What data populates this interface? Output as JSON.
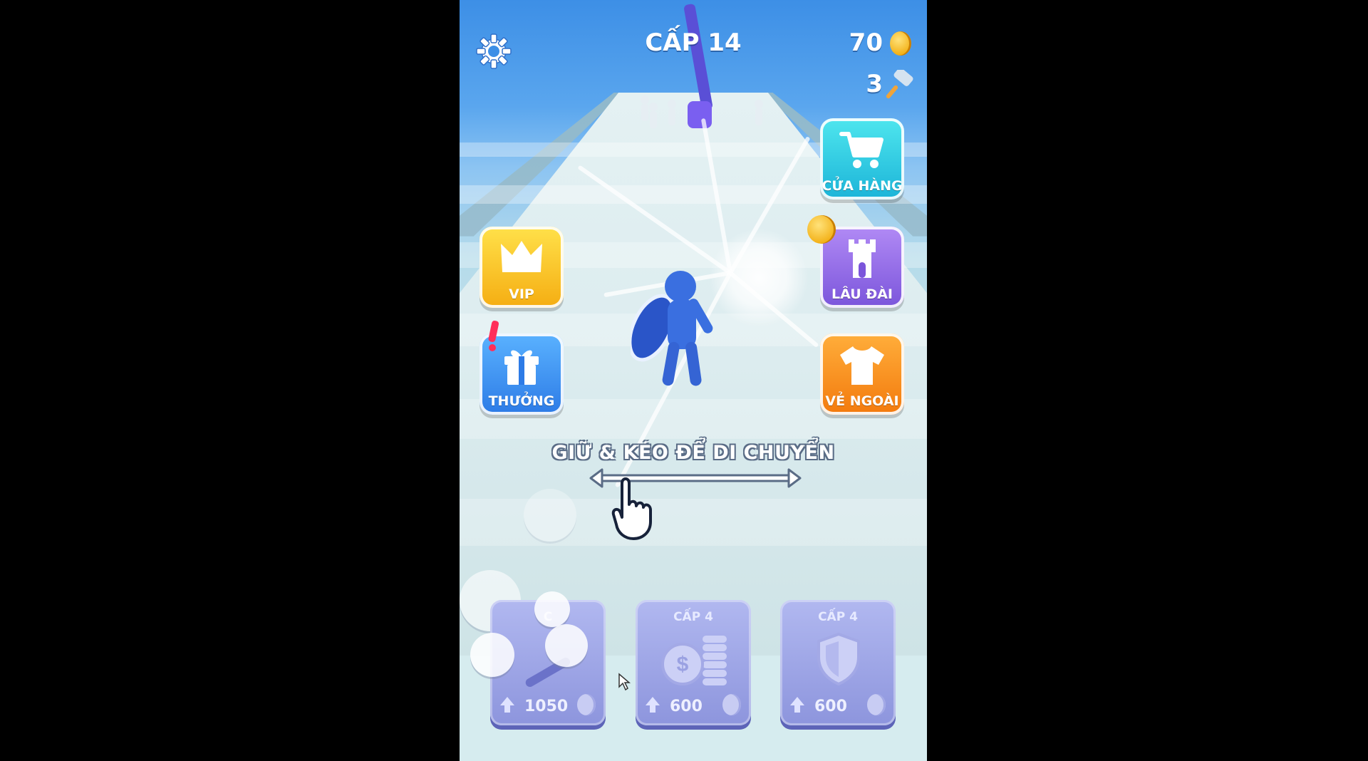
{
  "hud": {
    "level_label": "CẤP 14",
    "coins": "70",
    "hammers": "3"
  },
  "menu": {
    "shop": "CỬA HÀNG",
    "vip": "VIP",
    "castle": "LÂU ĐÀI",
    "reward": "THƯỞNG",
    "outfit": "VẺ NGOÀI"
  },
  "hint": "GIỮ & KÉO ĐỂ DI CHUYỂN",
  "upgrades": [
    {
      "level": "C",
      "price": "1050"
    },
    {
      "level": "CẤP 4",
      "price": "600"
    },
    {
      "level": "CẤP 4",
      "price": "600"
    }
  ],
  "colors": {
    "sky": "#3d8fe6",
    "coin": "#f3b21a",
    "card": "#a3aae8",
    "character": "#3a6fe0"
  }
}
